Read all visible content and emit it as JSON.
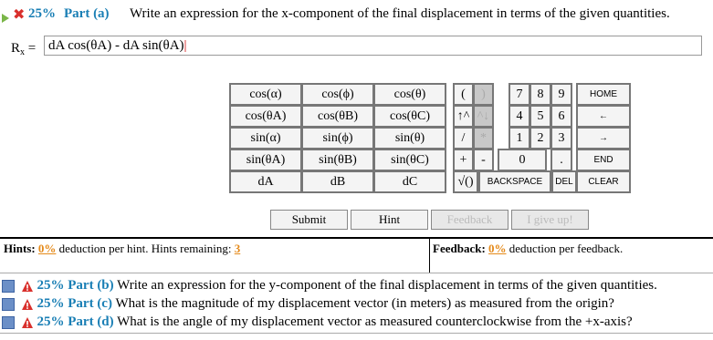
{
  "part_a": {
    "percent": "25%",
    "part_label": "Part (a)",
    "question": "Write an expression for the x-component of the final displacement in terms of the given quantities.",
    "answer_label": "R",
    "answer_label_sub": "x",
    "answer_eq": "=",
    "answer_value": "dA cos(θA) - dA sin(θA)"
  },
  "keypad": {
    "funcs": [
      [
        "cos(α)",
        "cos(ϕ)",
        "cos(θ)"
      ],
      [
        "cos(θA)",
        "cos(θB)",
        "cos(θC)"
      ],
      [
        "sin(α)",
        "sin(ϕ)",
        "sin(θ)"
      ],
      [
        "sin(θA)",
        "sin(θB)",
        "sin(θC)"
      ],
      [
        "dA",
        "dB",
        "dC"
      ]
    ],
    "ops": [
      [
        "(",
        ")"
      ],
      [
        "↑^",
        "^↓"
      ],
      [
        "/",
        "*"
      ],
      [
        "+",
        "-"
      ],
      [
        "√()",
        ""
      ]
    ],
    "digits": [
      [
        "7",
        "8",
        "9"
      ],
      [
        "4",
        "5",
        "6"
      ],
      [
        "1",
        "2",
        "3"
      ],
      [
        "0",
        "",
        "."
      ]
    ],
    "nav": [
      "HOME",
      "←",
      "→",
      "END"
    ],
    "bottom": [
      "BACKSPACE",
      "DEL",
      "CLEAR"
    ]
  },
  "actions": {
    "submit": "Submit",
    "hint": "Hint",
    "feedback": "Feedback",
    "give_up": "I give up!"
  },
  "hints": {
    "label": "Hints:",
    "pct": "0%",
    "text": "deduction per hint. Hints remaining:",
    "remaining": "3"
  },
  "feedback": {
    "label": "Feedback:",
    "pct": "0%",
    "text": "deduction per feedback."
  },
  "other_parts": [
    {
      "percent": "25%",
      "label": "Part (b)",
      "question": "Write an expression for the y-component of the final displacement in terms of the given quantities."
    },
    {
      "percent": "25%",
      "label": "Part (c)",
      "question": "What is the magnitude of my displacement vector (in meters) as measured from the origin?"
    },
    {
      "percent": "25%",
      "label": "Part (d)",
      "question": "What is the angle of my displacement vector as measured counterclockwise from the +x-axis?"
    }
  ]
}
